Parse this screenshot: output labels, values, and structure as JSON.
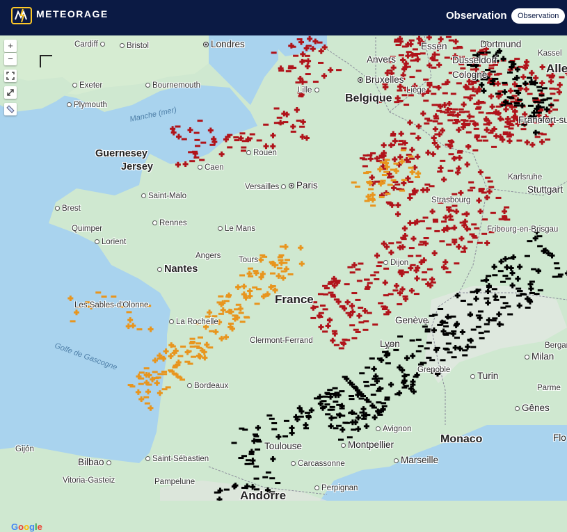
{
  "header": {
    "brand": "METEORAGE",
    "page_title": "Observation",
    "mode_button": "Observation"
  },
  "map_controls": {
    "zoom_in": "+",
    "zoom_out": "−"
  },
  "attribution": "Google",
  "colors": {
    "header_bg": "#0b1a44",
    "sea": "#a9d3ee",
    "land": "#cfe8d0",
    "strike_recent": "#b0131a",
    "strike_orange": "#e8951e",
    "strike_old": "#000000"
  },
  "places": {
    "cardiff": "Cardiff",
    "bristol": "Bristol",
    "londres": "Londres",
    "exeter": "Exeter",
    "bournemouth": "Bournemouth",
    "plymouth": "Plymouth",
    "manche": "Manche (mer)",
    "guernesey": "Guernesey",
    "jersey": "Jersey",
    "caen": "Caen",
    "rouen": "Rouen",
    "lille": "Lille",
    "bruxelles": "Bruxelles",
    "belgique": "Belgique",
    "anvers": "Anvers",
    "liege": "Liège",
    "essen": "Essen",
    "dortmund": "Dortmund",
    "dusseldorf": "Düsseldorf",
    "cologne": "Cologne",
    "kassel": "Kassel",
    "allemagne": "Allem",
    "francfort": "Francfort-su",
    "versailles": "Versailles",
    "paris": "Paris",
    "brest": "Brest",
    "saint_malo": "Saint-Malo",
    "quimper": "Quimper",
    "rennes": "Rennes",
    "lorient": "Lorient",
    "le_mans": "Le Mans",
    "angers": "Angers",
    "tours": "Tours",
    "nantes": "Nantes",
    "france": "France",
    "dijon": "Dijon",
    "strasbourg": "Strasbourg",
    "karlsruhe": "Karlsruhe",
    "stuttgart": "Stuttgart",
    "fribourg": "Fribourg-en-Brisgau",
    "sables": "Les Sables-d'Olonne",
    "la_rochelle": "La Rochelle",
    "clermont": "Clermont-Ferrand",
    "geneve": "Genève",
    "lyon": "Lyon",
    "grenoble": "Grenoble",
    "milan": "Milan",
    "turin": "Turin",
    "bergame": "Bergame",
    "parme": "Parme",
    "genes": "Gênes",
    "golfe": "Golfe de Gascogne",
    "bordeaux": "Bordeaux",
    "avignon": "Avignon",
    "monaco": "Monaco",
    "florence": "Flo",
    "toulouse": "Toulouse",
    "montpellier": "Montpellier",
    "marseille": "Marseille",
    "carcassonne": "Carcassonne",
    "gijon": "Gijón",
    "bilbao": "Bilbao",
    "saint_sebastien": "Saint-Sébastien",
    "vitoria": "Vitoria-Gasteiz",
    "pampelune": "Pampelune",
    "perpignan": "Perpignan",
    "andorre": "Andorre"
  }
}
